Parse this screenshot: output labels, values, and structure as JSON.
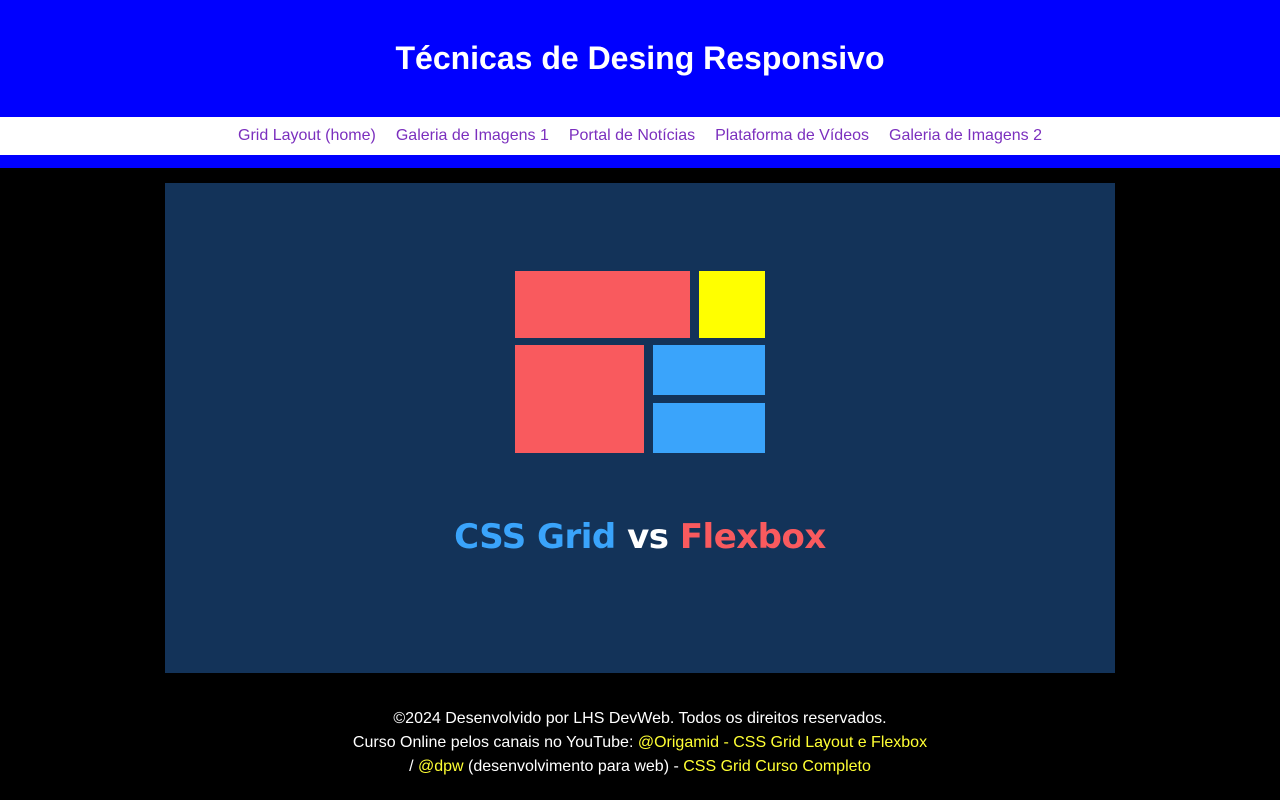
{
  "header": {
    "title": "Técnicas de Desing Responsivo"
  },
  "nav": {
    "items": [
      {
        "label": "Grid Layout (home)"
      },
      {
        "label": "Galeria de Imagens 1"
      },
      {
        "label": "Portal de Notícias"
      },
      {
        "label": "Plataforma de Vídeos"
      },
      {
        "label": "Galeria de Imagens 2"
      }
    ]
  },
  "banner": {
    "title_part1": "CSS Grid",
    "title_part2": "vs",
    "title_part3": "Flexbox"
  },
  "footer": {
    "copyright": "©2024 Desenvolvido por LHS DevWeb. Todos os direitos reservados.",
    "course_prefix": "Curso Online pelos canais no YouTube: ",
    "link_origamid": "@Origamid - CSS Grid Layout e Flexbox",
    "separator": "/ ",
    "link_dpw": "@dpw",
    "dpw_desc": " (desenvolvimento para web) - ",
    "link_complete": "CSS Grid Curso Completo"
  },
  "colors": {
    "header_bg": "#0000ff",
    "nav_link": "#7b2fbe",
    "banner_bg": "#133359",
    "red": "#f95a5e",
    "blue": "#3aa4fb",
    "yellow": "#ffff00",
    "footer_link": "#ffff33"
  }
}
